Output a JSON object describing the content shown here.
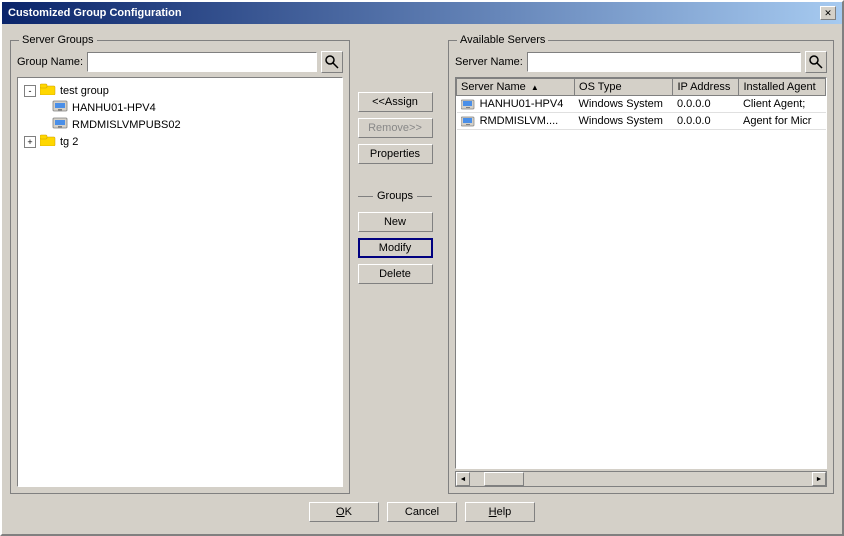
{
  "dialog": {
    "title": "Customized Group Configuration",
    "close_label": "✕"
  },
  "left_panel": {
    "legend": "Server Groups",
    "group_name_label": "Group Name:",
    "group_name_placeholder": "",
    "tree": {
      "items": [
        {
          "id": "root",
          "label": "test group",
          "type": "folder",
          "expanded": true,
          "level": 0
        },
        {
          "id": "child1",
          "label": "HANHU01-HPV4",
          "type": "server",
          "level": 1
        },
        {
          "id": "child2",
          "label": "RMDMISLVMPUBS02",
          "type": "server",
          "level": 1
        },
        {
          "id": "tg2",
          "label": "tg 2",
          "type": "folder",
          "expanded": false,
          "level": 0
        }
      ]
    }
  },
  "right_panel": {
    "legend": "Available Servers",
    "server_name_label": "Server Name:",
    "server_name_placeholder": "",
    "table": {
      "columns": [
        {
          "id": "name",
          "label": "Server Name",
          "sort": "asc"
        },
        {
          "id": "os",
          "label": "OS Type"
        },
        {
          "id": "ip",
          "label": "IP Address"
        },
        {
          "id": "agent",
          "label": "Installed Agent"
        }
      ],
      "rows": [
        {
          "name": "HANHU01-HPV4",
          "os": "Windows System",
          "ip": "0.0.0.0",
          "agent": "Client Agent;"
        },
        {
          "name": "RMDMISLVM....",
          "os": "Windows System",
          "ip": "0.0.0.0",
          "agent": "Agent for Micr"
        }
      ]
    }
  },
  "middle": {
    "assign_label": "<<Assign",
    "remove_label": "Remove>>",
    "properties_label": "Properties",
    "groups_label": "Groups",
    "new_label": "New",
    "modify_label": "Modify",
    "delete_label": "Delete"
  },
  "bottom": {
    "ok_label": "OK",
    "cancel_label": "Cancel",
    "help_label": "Help"
  },
  "icons": {
    "search": "🔍",
    "folder": "📁",
    "server": "🖥",
    "left_arrow": "◄",
    "right_arrow": "►"
  }
}
